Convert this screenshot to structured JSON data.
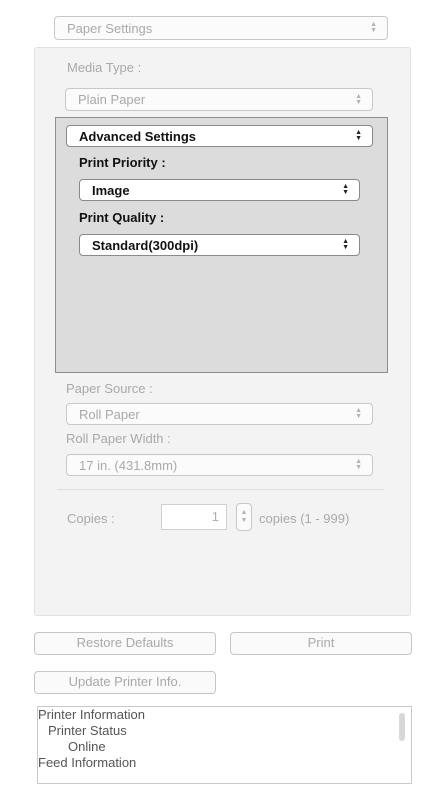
{
  "top_popup": {
    "value": "Paper Settings"
  },
  "media_type": {
    "label": "Media Type :",
    "value": "Plain Paper"
  },
  "advanced": {
    "title": "Advanced Settings",
    "print_priority": {
      "label": "Print Priority :",
      "value": "Image"
    },
    "print_quality": {
      "label": "Print Quality :",
      "value": "Standard(300dpi)"
    }
  },
  "paper_source": {
    "label": "Paper Source :",
    "value": "Roll Paper"
  },
  "roll_paper_width": {
    "label": "Roll Paper Width :",
    "value": "17 in. (431.8mm)"
  },
  "copies": {
    "label": "Copies :",
    "value": "1",
    "range": "copies (1 - 999)"
  },
  "buttons": {
    "restore_defaults": "Restore Defaults",
    "print": "Print",
    "update_printer_info": "Update Printer Info."
  },
  "info_list": {
    "items": [
      "Printer Information",
      "Printer Status",
      "Online",
      "Feed Information"
    ]
  }
}
